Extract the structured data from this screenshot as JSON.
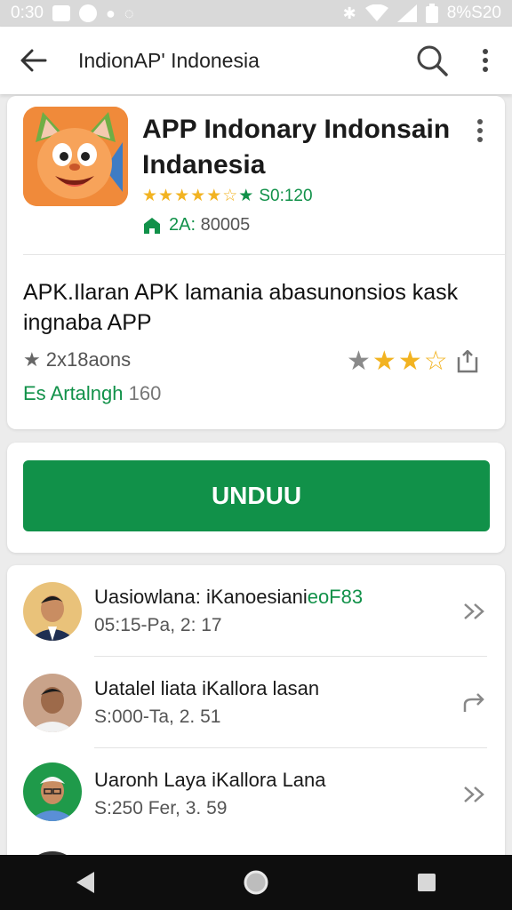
{
  "status_bar": {
    "time": "0:30",
    "battery_text": "8%S20",
    "icons": [
      "image-icon",
      "settings-icon",
      "circle-icon",
      "alarm-icon",
      "bluetooth-icon",
      "wifi-icon",
      "signal-icon",
      "battery-icon"
    ]
  },
  "app_bar": {
    "title": "IndionAP' Indonesia",
    "icons": [
      "back-arrow-icon",
      "search-icon",
      "more-vert-icon"
    ]
  },
  "app": {
    "title": "APP Indonary Indonsain Indanesia",
    "rating_value": "S0:120",
    "downloads_prefix": "2A:",
    "downloads_value": "80005",
    "description": "APK.Ilaran APK lamania abasunonsios kask ingnaba APP",
    "meta_text": "2x18aons",
    "rating_stars": 3,
    "rating_stars_total": 5,
    "developer_name": "Es Artalngh",
    "developer_count": "160",
    "icon_colors": {
      "background": "#f08a3a",
      "face": "#f7a35a"
    }
  },
  "install": {
    "button_label": "UNDUU"
  },
  "list": {
    "items": [
      {
        "title": "Uasiowlana: iKanoesiani",
        "title_accent": "eoF83",
        "subtitle": "05:15-Pa, 2: 17",
        "chevron": "double-chevron-right-icon"
      },
      {
        "title": "Uatalel liata iKallora lasan",
        "title_accent": "",
        "subtitle": "S:000-Ta, 2. 51",
        "chevron": "share-arrow-icon"
      },
      {
        "title": "Uaronh Laya iKallora Lana",
        "title_accent": "",
        "subtitle": "S:250  Fer, 3. 59",
        "chevron": "double-chevron-right-icon"
      }
    ]
  },
  "colors": {
    "accent_green": "#119149",
    "star_gold": "#f2b321",
    "star_gray": "#8a8a8a",
    "status_bar_bg": "#d9d9d9",
    "nav_bar_bg": "#0e0e0e"
  },
  "nav_bar": {
    "icons": [
      "nav-back-icon",
      "nav-home-icon",
      "nav-recents-icon"
    ]
  }
}
